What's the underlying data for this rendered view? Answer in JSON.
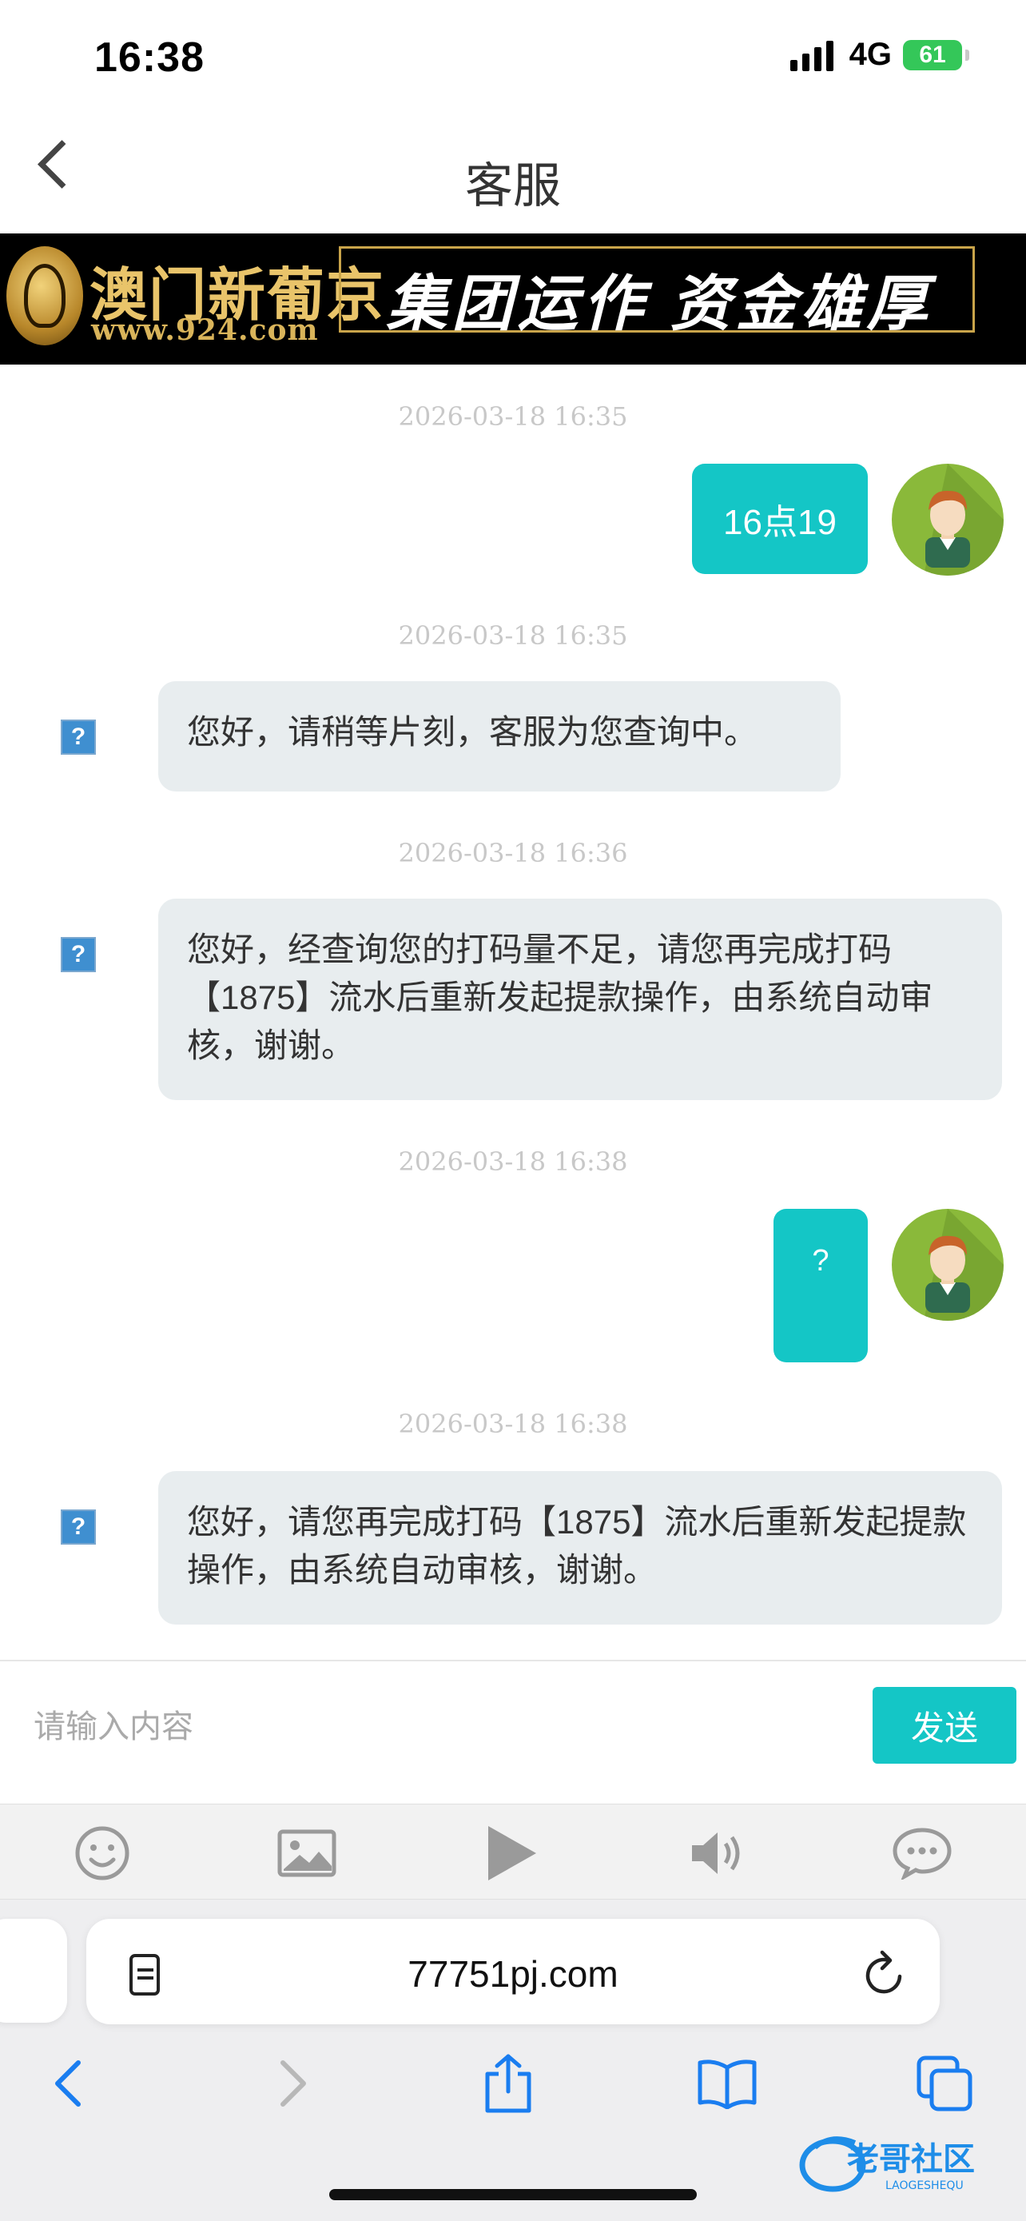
{
  "status": {
    "time": "16:38",
    "network": "4G",
    "battery": "61"
  },
  "header": {
    "title": "客服"
  },
  "banner": {
    "brand": "澳门新葡京",
    "url": "www.924.com",
    "slogan": "集团运作  资金雄厚"
  },
  "messages": [
    {
      "timestamp": "2026-03-18 16:35",
      "from": "user",
      "text": "16点19"
    },
    {
      "timestamp": "2026-03-18 16:35",
      "from": "service",
      "text": "您好，请稍等片刻，客服为您查询中。"
    },
    {
      "timestamp": "2026-03-18 16:36",
      "from": "service",
      "text": "您好，经查询您的打码量不足，请您再完成打码【1875】流水后重新发起提款操作，由系统自动审核，谢谢。"
    },
    {
      "timestamp": "2026-03-18 16:38",
      "from": "user",
      "text": "?"
    },
    {
      "timestamp": "2026-03-18 16:38",
      "from": "service",
      "text": "您好，请您再完成打码【1875】流水后重新发起提款操作，由系统自动审核，谢谢。"
    }
  ],
  "input": {
    "placeholder": "请输入内容",
    "send_label": "发送"
  },
  "toolbar": {
    "icons": [
      "emoji-icon",
      "image-icon",
      "play-icon",
      "speaker-icon",
      "chat-icon"
    ]
  },
  "browser": {
    "url": "77751pj.com"
  },
  "watermark": {
    "text": "老哥社区",
    "subtext": "LAOGESHEQU"
  },
  "colors": {
    "accent": "#14c6c6",
    "avatar_bg": "#8ab93a",
    "battery": "#34c759"
  }
}
